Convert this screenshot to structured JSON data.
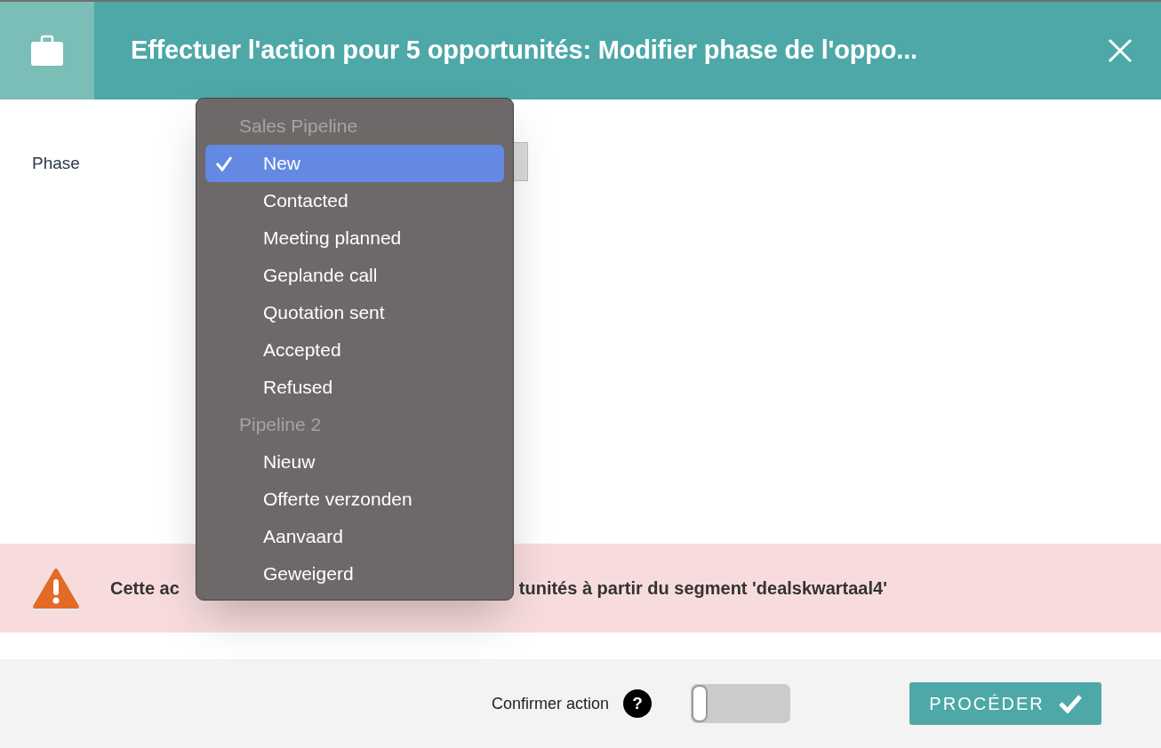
{
  "header": {
    "title": "Effectuer l'action pour 5 opportunités: Modifier phase de l'oppo..."
  },
  "form": {
    "phase_label": "Phase"
  },
  "dropdown": {
    "groups": [
      {
        "label": "Sales Pipeline",
        "options": [
          {
            "label": "New",
            "selected": true
          },
          {
            "label": "Contacted",
            "selected": false
          },
          {
            "label": "Meeting planned",
            "selected": false
          },
          {
            "label": "Geplande call",
            "selected": false
          },
          {
            "label": "Quotation sent",
            "selected": false
          },
          {
            "label": "Accepted",
            "selected": false
          },
          {
            "label": "Refused",
            "selected": false
          }
        ]
      },
      {
        "label": "Pipeline 2",
        "options": [
          {
            "label": "Nieuw",
            "selected": false
          },
          {
            "label": "Offerte verzonden",
            "selected": false
          },
          {
            "label": "Aanvaard",
            "selected": false
          },
          {
            "label": "Geweigerd",
            "selected": false
          }
        ]
      }
    ]
  },
  "alert": {
    "text_visible_start": "Cette ac",
    "text_visible_end": "tunités à partir du segment 'dealskwartaal4'"
  },
  "footer": {
    "confirm_label": "Confirmer action",
    "help": "?",
    "confirm_toggle": {
      "on": false
    },
    "proceed_button": "PROCÉDER"
  }
}
